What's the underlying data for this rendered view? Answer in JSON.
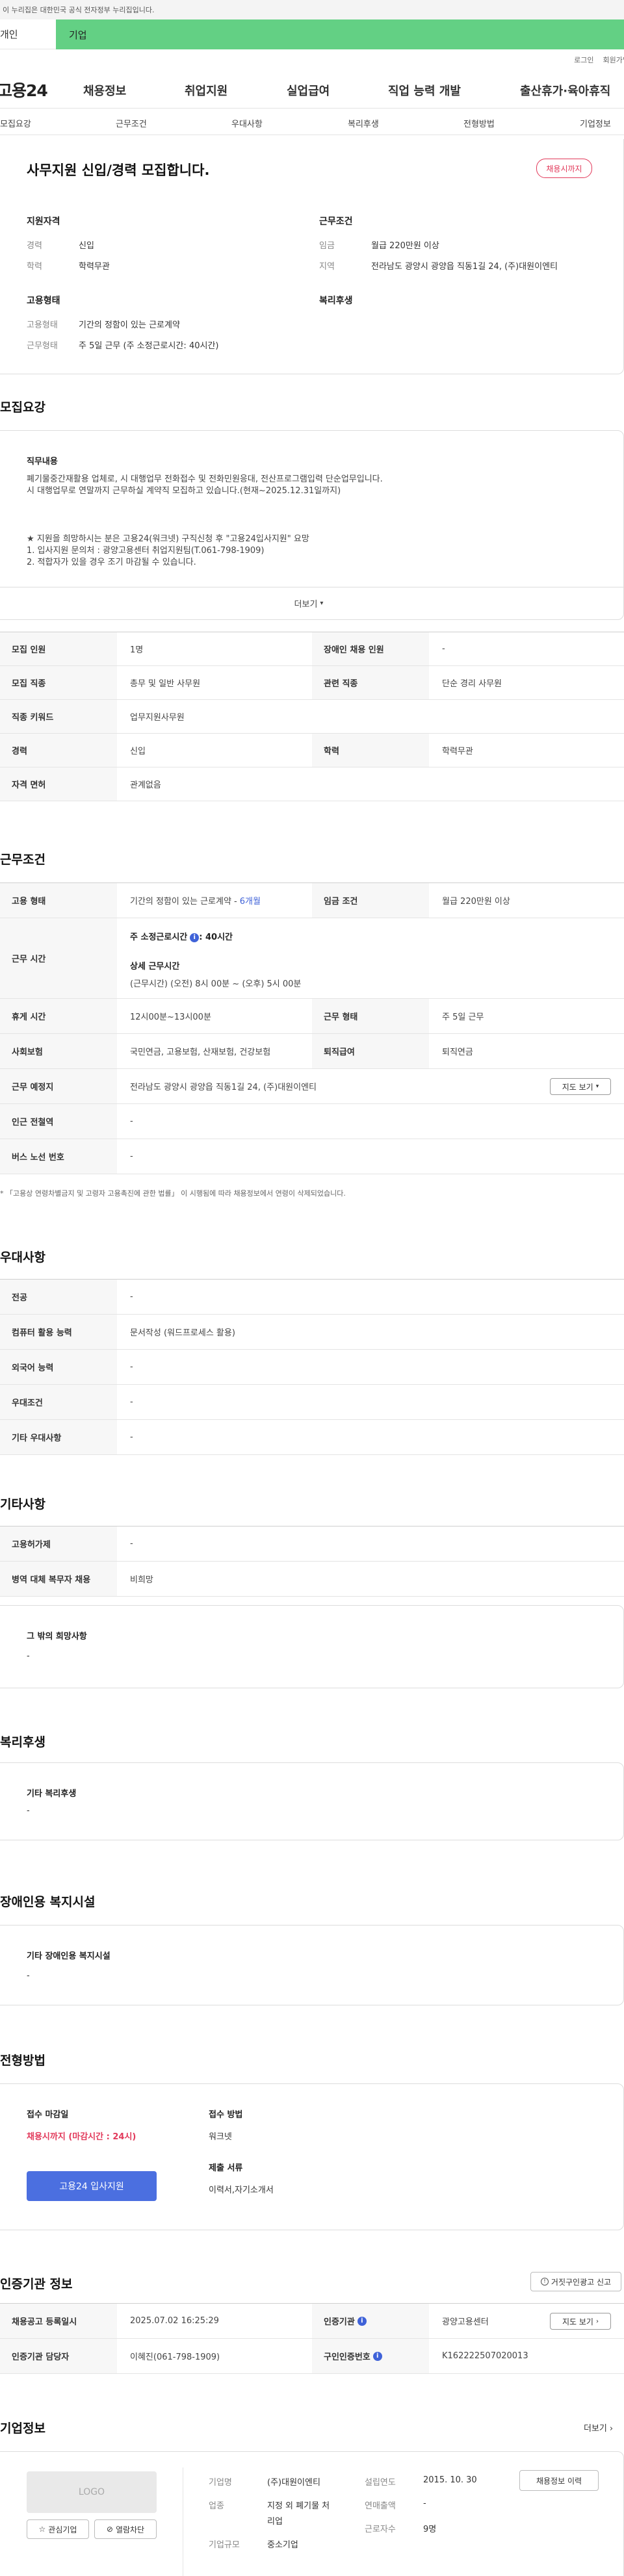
{
  "gov_banner": "이 누리집은 대한민국 공식 전자정부 누리집입니다.",
  "flag_tabs": {
    "left": "개인",
    "right": "기업"
  },
  "util": {
    "login": "로그인",
    "join": "회원가입"
  },
  "logo": "고용24",
  "gnb": [
    "채용정보",
    "취업지원",
    "실업급여",
    "직업 능력 개발",
    "출산휴가·육아휴직"
  ],
  "anchor_tabs": [
    "모집요강",
    "근무조건",
    "우대사항",
    "복리후생",
    "전형방법",
    "기업정보"
  ],
  "summary": {
    "title": "사무지원 신입/경력 모집합니다.",
    "badge": "채용시까지",
    "qual_title": "지원자격",
    "career_label": "경력",
    "career": "신입",
    "edu_label": "학력",
    "edu": "학력무관",
    "cond_title": "근무조건",
    "wage_label": "임금",
    "wage": "월급 220만원 이상",
    "area_label": "지역",
    "area": "전라남도 광양시 광양읍 직동1길 24, (주)대원이엔티",
    "emp_title": "고용형태",
    "emp_type_label": "고용형태",
    "emp_type": "기간의 정함이 있는 근로계약",
    "work_type_label": "근무형태",
    "work_type": "주 5일 근무 (주 소정근로시간: 40시간)",
    "welfare_title": "복리후생"
  },
  "recruit": {
    "heading": "모집요강",
    "duty_title": "직무내용",
    "duty_lines": [
      "폐기물중간재활용 업체로, 시 대행업무 전화접수 및 전화민원응대, 전산프로그램입력  단순업무입니다.",
      "시 대행업무로 연말까지 근무하실 계약직 모집하고 있습니다.(현재~2025.12.31일까지)",
      "",
      "",
      "★ 지원을 희망하시는 분은 고용24(워크넷)  구직신청 후 \"고용24입사지원\" 요망",
      "1. 입사지원 문의처 : 광양고용센터 취업지원팀(T.061-798-1909)",
      "2. 적합자가 있을 경우 조기 마감될 수 있습니다."
    ],
    "more": "더보기",
    "rows": [
      [
        "모집 인원",
        "1명",
        "장애인 채용 인원",
        "-"
      ],
      [
        "모집 직종",
        "총무 및 일반 사무원",
        "관련 직종",
        "단순 경리 사무원"
      ],
      [
        "직종 키워드",
        "업무지원사무원"
      ],
      [
        "경력",
        "신입",
        "학력",
        "학력무관"
      ],
      [
        "자격 면허",
        "관계없음"
      ]
    ]
  },
  "work": {
    "heading": "근무조건",
    "emp_label": "고용 형태",
    "emp_val": "기간의 정함이 있는 근로계약 -",
    "emp_months": "6개월",
    "wage_label": "임금 조건",
    "wage_val": "월급 220만원 이상",
    "hours_label": "근무 시간",
    "hours_line1": "주 소정근로시간",
    "hours_line1b": ": 40시간",
    "hours_sub": "상세 근무시간",
    "hours_detail": "(근무시간) (오전) 8시 00분 ~ (오후) 5시 00분",
    "rest_label": "휴게 시간",
    "rest_val": "12시00분~13시00분",
    "shift_label": "근무 형태",
    "shift_val": "주 5일 근무",
    "ins_label": "사회보험",
    "ins_val": "국민연금, 고용보험, 산재보험, 건강보험",
    "retire_label": "퇴직급여",
    "retire_val": "퇴직연금",
    "place_label": "근무 예정지",
    "place_val": "전라남도 광양시 광양읍 직동1길 24, (주)대원이엔티",
    "map_btn": "지도 보기",
    "station_label": "인근 전철역",
    "station_val": "-",
    "bus_label": "버스 노선 번호",
    "bus_val": "-",
    "note": "* 「고용상 연령차별금지 및 고령자 고용촉진에 관한 법률」 이 시행됨에 따라 채용정보에서 연령이 삭제되었습니다."
  },
  "pref": {
    "heading": "우대사항",
    "rows": [
      [
        "전공",
        "-"
      ],
      [
        "컴퓨터 활용 능력",
        "문서작성 (워드프로세스 활용)"
      ],
      [
        "외국어 능력",
        "-"
      ],
      [
        "우대조건",
        "-"
      ],
      [
        "기타 우대사항",
        "-"
      ]
    ]
  },
  "etc": {
    "heading": "기타사항",
    "rows": [
      [
        "고용허가제",
        "-"
      ],
      [
        "병역 대체 복무자 채용",
        "비희망"
      ]
    ],
    "wish_title": "그 밖의 희망사항",
    "wish_val": "-"
  },
  "welfare": {
    "heading": "복리후생",
    "title": "기타 복리후생",
    "val": "-"
  },
  "disab": {
    "heading": "장애인용 복지시설",
    "title": "기타 장애인용 복지시설",
    "val": "-"
  },
  "select": {
    "heading": "전형방법",
    "deadline_label": "접수 마감일",
    "deadline_val": "채용시까지 (마감시간 : 24시)",
    "apply_btn": "고용24 입사지원",
    "method_label": "접수 방법",
    "method_val": "워크넷",
    "docs_label": "제출 서류",
    "docs_val": "이력서,자기소개서"
  },
  "agency": {
    "heading": "인증기관 정보",
    "report_btn": "거짓구인광고 신고",
    "rows": [
      [
        "채용공고 등록일시",
        "2025.07.02 16:25:29",
        "인증기관",
        "광양고용센터"
      ],
      [
        "인증기관 담당자",
        "이혜진(061-798-1909)",
        "구인인증번호",
        "K162222507020013"
      ]
    ],
    "map_btn": "지도 보기"
  },
  "company": {
    "heading": "기업정보",
    "more": "더보기",
    "logo": "LOGO",
    "fav_btn": "관심기업",
    "block_btn": "열람차단",
    "name_label": "기업명",
    "name_val": "(주)대원이엔티",
    "year_label": "설립연도",
    "year_val": "2015. 10. 30",
    "history_btn": "채용정보 이력",
    "biz_label": "업종",
    "biz_val_1": "지정 외 폐기물 처",
    "biz_val_2": "리업",
    "sales_label": "연매출액",
    "sales_val": "-",
    "size_label": "기업규모",
    "size_val": "중소기업",
    "emp_label": "근로자수",
    "emp_val": "9명"
  }
}
